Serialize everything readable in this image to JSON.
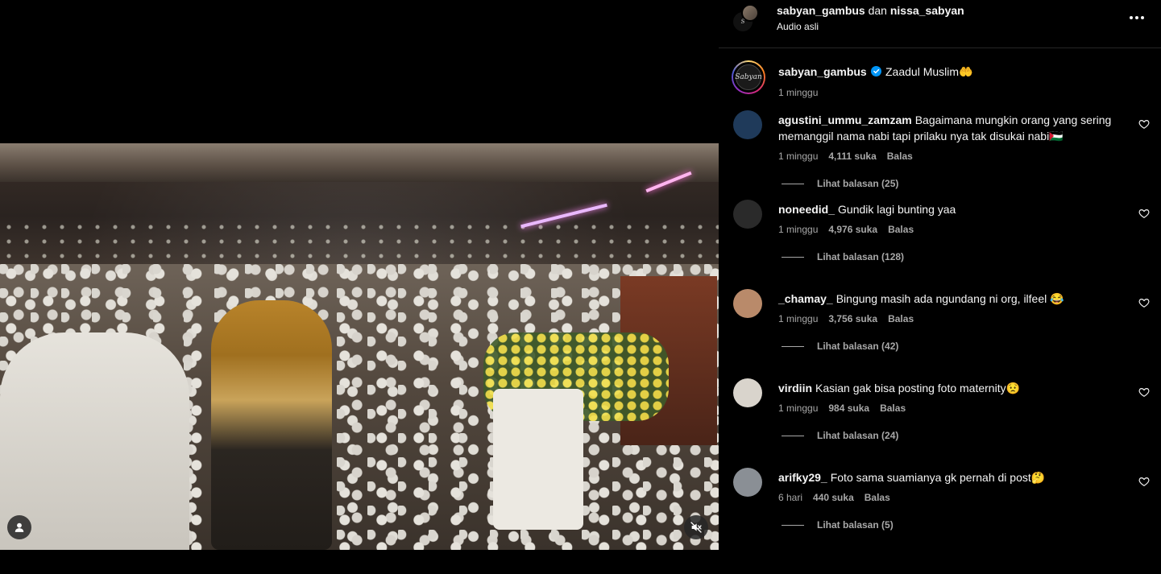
{
  "post": {
    "owners": {
      "primary": "sabyan_gambus",
      "joiner": "dan",
      "secondary": "nissa_sabyan"
    },
    "audio": "Audio asli",
    "more_icon": "more-horizontal-icon"
  },
  "caption": {
    "avatar_text": "Sabyan",
    "username": "sabyan_gambus",
    "verified": true,
    "text": "Zaadul Muslim🤲",
    "time": "1 minggu"
  },
  "comments": [
    {
      "username": "agustini_ummu_zamzam",
      "text": "Bagaimana mungkin orang yang sering memanggil nama nabi tapi prilaku nya tak disukai nabi🇵🇸",
      "time": "1 minggu",
      "likes": "4,111 suka",
      "reply": "Balas",
      "view_replies": "Lihat balasan (25)",
      "avatar_color": "#1f3a5a"
    },
    {
      "username": "noneedid_",
      "text": "Gundik lagi bunting yaa",
      "time": "1 minggu",
      "likes": "4,976 suka",
      "reply": "Balas",
      "view_replies": "Lihat balasan (128)",
      "avatar_color": "#2a2a2a"
    },
    {
      "username": "_chamay_",
      "text": "Bingung masih ada ngundang ni org, ilfeel 😂",
      "time": "1 minggu",
      "likes": "3,756 suka",
      "reply": "Balas",
      "view_replies": "Lihat balasan (42)",
      "avatar_color": "#b98a6a"
    },
    {
      "username": "virdiin",
      "text": "Kasian gak bisa posting foto maternity😟",
      "time": "1 minggu",
      "likes": "984 suka",
      "reply": "Balas",
      "view_replies": "Lihat balasan (24)",
      "avatar_color": "#d9d4cc"
    },
    {
      "username": "arifky29_",
      "text": "Foto sama suamianya gk pernah di post🤔",
      "time": "6 hari",
      "likes": "440 suka",
      "reply": "Balas",
      "view_replies": "Lihat balasan (5)",
      "avatar_color": "#8a8f95"
    }
  ],
  "colors": {
    "background": "#000000",
    "text_primary": "#f5f5f5",
    "text_secondary": "#a8a8a8",
    "verified": "#0095f6"
  },
  "icons": {
    "user_tag": "user-tag-icon",
    "mute": "volume-muted-icon",
    "like": "heart-outline-icon"
  }
}
